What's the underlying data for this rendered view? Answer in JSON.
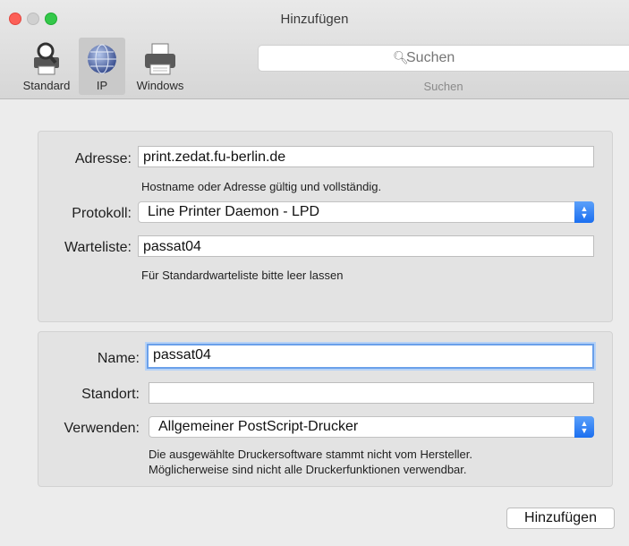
{
  "window": {
    "title": "Hinzufügen"
  },
  "toolbar": {
    "buttons": [
      {
        "label": "Standard",
        "icon": "magnifier-printer-icon"
      },
      {
        "label": "IP",
        "icon": "globe-icon",
        "selected": true
      },
      {
        "label": "Windows",
        "icon": "printer-icon"
      }
    ],
    "search": {
      "placeholder": "Suchen",
      "caption": "Suchen"
    }
  },
  "ip_panel": {
    "address_label": "Adresse:",
    "address_value": "print.zedat.fu-berlin.de",
    "address_hint": "Hostname oder Adresse gültig und vollständig.",
    "protocol_label": "Protokoll:",
    "protocol_value": "Line Printer Daemon - LPD",
    "queue_label": "Warteliste:",
    "queue_value": "passat04",
    "queue_hint": "Für Standardwarteliste bitte leer lassen"
  },
  "printer_panel": {
    "name_label": "Name:",
    "name_value": "passat04",
    "location_label": "Standort:",
    "location_value": "",
    "use_label": "Verwenden:",
    "use_value": "Allgemeiner PostScript-Drucker",
    "use_hint_line1": "Die ausgewählte Druckersoftware stammt nicht vom Hersteller.",
    "use_hint_line2": "Möglicherweise sind nicht alle Druckerfunktionen verwendbar."
  },
  "footer": {
    "add_button": "Hinzufügen"
  },
  "colors": {
    "accent": "#1b6ff0",
    "focus_ring": "#6aa0ea"
  }
}
